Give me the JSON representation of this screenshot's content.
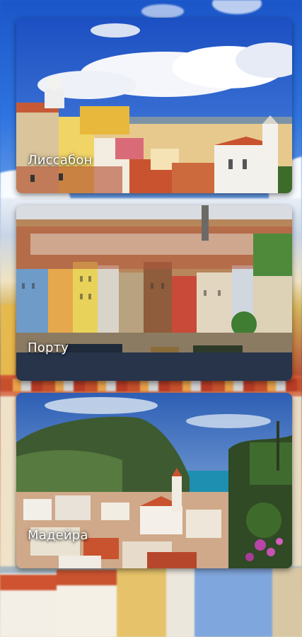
{
  "destinations": [
    {
      "name": "Лиссабон"
    },
    {
      "name": "Порту"
    },
    {
      "name": "Мадейра"
    }
  ],
  "colors": {
    "sky": "#2f74df",
    "roof": "#c9532e",
    "label_text": "#ffffff"
  }
}
